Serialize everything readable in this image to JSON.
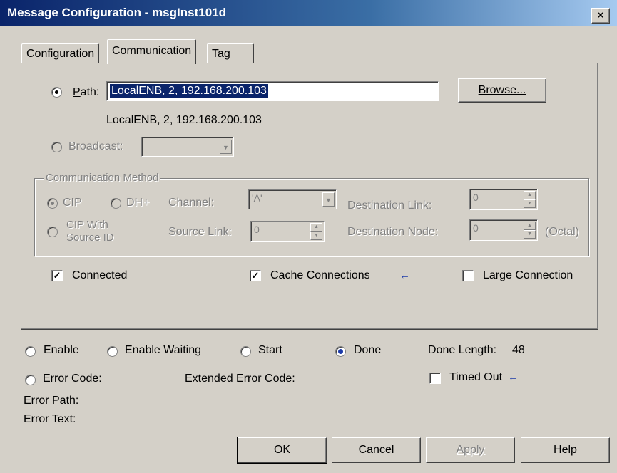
{
  "window": {
    "title": "Message Configuration - msgInst101d",
    "close": "×"
  },
  "tabs": [
    {
      "label": "Configuration"
    },
    {
      "label": "Communication"
    },
    {
      "label": "Tag"
    }
  ],
  "communication": {
    "path_label": "Path:",
    "path_value": "LocalENB, 2, 192.168.200.103",
    "path_resolved": "LocalENB, 2, 192.168.200.103",
    "browse_label": "Browse...",
    "broadcast_label": "Broadcast:",
    "method": {
      "title": "Communication Method",
      "cip_label": "CIP",
      "dh_label": "DH+",
      "cip_with_source_id_label_1": "CIP With",
      "cip_with_source_id_label_2": "Source ID",
      "channel_label": "Channel:",
      "channel_value": "'A'",
      "destination_link_label": "Destination Link:",
      "destination_link_value": "0",
      "source_link_label": "Source Link:",
      "source_link_value": "0",
      "destination_node_label": "Destination Node:",
      "destination_node_value": "0",
      "octal_label": "(Octal)"
    },
    "connected_label": "Connected",
    "cache_connections_label": "Cache Connections",
    "large_connection_label": "Large Connection"
  },
  "status": {
    "enable_label": "Enable",
    "enable_waiting_label": "Enable Waiting",
    "start_label": "Start",
    "done_label": "Done",
    "done_length_label": "Done Length:",
    "done_length_value": "48",
    "error_code_label": "Error Code:",
    "extended_error_code_label": "Extended Error Code:",
    "timed_out_label": "Timed Out",
    "error_path_label": "Error Path:",
    "error_text_label": "Error Text:"
  },
  "buttons": {
    "ok": "OK",
    "cancel": "Cancel",
    "apply": "Apply",
    "help": "Help"
  },
  "colors": {
    "titlebar_start": "#0a246a",
    "titlebar_end": "#a6caf0",
    "face": "#d4d0c8",
    "arrow": "#1c3aa9"
  },
  "icons": {
    "arrow": "←",
    "dropdown": "▼",
    "spin_up": "▲",
    "spin_down": "▼",
    "check": "✓"
  }
}
